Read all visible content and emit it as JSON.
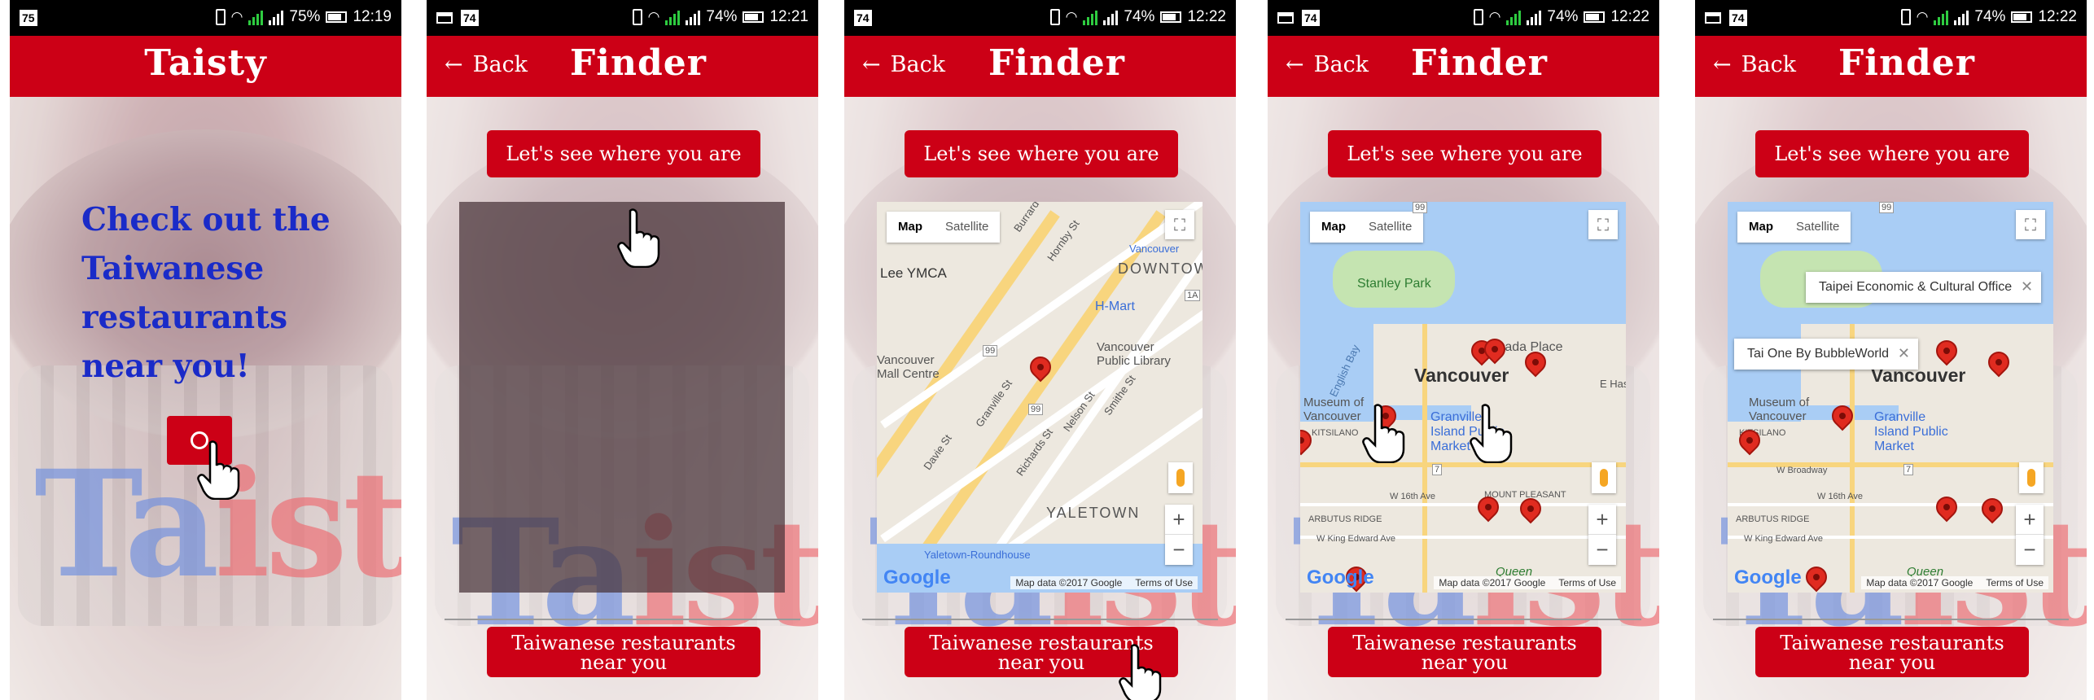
{
  "screens": [
    {
      "status": {
        "badge": "75",
        "battery": "75%",
        "time": "12:19"
      },
      "app_title": "Taisty",
      "tagline": "Check out the Taiwanese restaurants near you!",
      "logo": {
        "part1": "Ta",
        "part2": "isty"
      },
      "search_icon": "search-icon"
    },
    {
      "status": {
        "badge": "74",
        "battery": "74%",
        "time": "12:21"
      },
      "back_label": "Back",
      "title": "Finder",
      "locate_label": "Let's see where you are",
      "nearby_label": "Taiwanese restaurants near you",
      "logo": {
        "part1": "Ta",
        "part2": "isty"
      }
    },
    {
      "status": {
        "badge": "74",
        "battery": "74%",
        "time": "12:22"
      },
      "back_label": "Back",
      "title": "Finder",
      "locate_label": "Let's see where you are",
      "nearby_label": "Taiwanese restaurants near you",
      "logo": {
        "part1": "Ta",
        "part2": "isty"
      },
      "map": {
        "type_map": "Map",
        "type_satellite": "Satellite",
        "google": "Google",
        "attribution": "Map data ©2017 Google",
        "terms": "Terms of Use",
        "labels": [
          "Lee YMCA",
          "DOWNTOWN",
          "H-Mart",
          "Vancouver Public Library",
          "Vancouver Mall Centre",
          "YALETOWN",
          "Yaletown-Roundhouse",
          "Granville St",
          "Richards St",
          "Nelson St",
          "Smithe St",
          "Davie St",
          "Hornby St",
          "Burrard",
          "Vancouver"
        ],
        "route_shields": [
          "99",
          "99",
          "1A"
        ]
      }
    },
    {
      "status": {
        "badge": "74",
        "battery": "74%",
        "time": "12:22"
      },
      "back_label": "Back",
      "title": "Finder",
      "locate_label": "Let's see where you are",
      "nearby_label": "Taiwanese restaurants near you",
      "logo": {
        "part1": "Ta",
        "part2": "isty"
      },
      "map": {
        "type_map": "Map",
        "type_satellite": "Satellite",
        "google": "Google",
        "attribution": "Map data ©2017 Google",
        "terms": "Terms of Use",
        "labels": [
          "Stanley Park",
          "English Bay",
          "Canada Place",
          "Vancouver",
          "Museum of Vancouver",
          "KITSILANO",
          "Granville Island Public Market",
          "E Hast",
          "MOUNT PLEASANT",
          "ARBUTUS RIDGE",
          "W 16th Ave",
          "W King Edward Ave",
          "Queen"
        ],
        "route_shields": [
          "99",
          "7"
        ]
      }
    },
    {
      "status": {
        "badge": "74",
        "battery": "74%",
        "time": "12:22"
      },
      "back_label": "Back",
      "title": "Finder",
      "locate_label": "Let's see where you are",
      "nearby_label": "Taiwanese restaurants near you",
      "logo": {
        "part1": "Ta",
        "part2": "isty"
      },
      "map": {
        "type_map": "Map",
        "type_satellite": "Satellite",
        "google": "Google",
        "attribution": "Map data ©2017 Google",
        "terms": "Terms of Use",
        "labels": [
          "Vancouver",
          "Museum of Vancouver",
          "KITSILANO",
          "Granville Island Public Market",
          "W Broadway",
          "ARBUTUS RIDGE",
          "W 16th Ave",
          "W King Edward Ave",
          "Queen"
        ],
        "route_shields": [
          "99",
          "7"
        ],
        "popups": [
          "Taipei Economic & Cultural Office",
          "Tai One By BubbleWorld"
        ]
      }
    }
  ]
}
